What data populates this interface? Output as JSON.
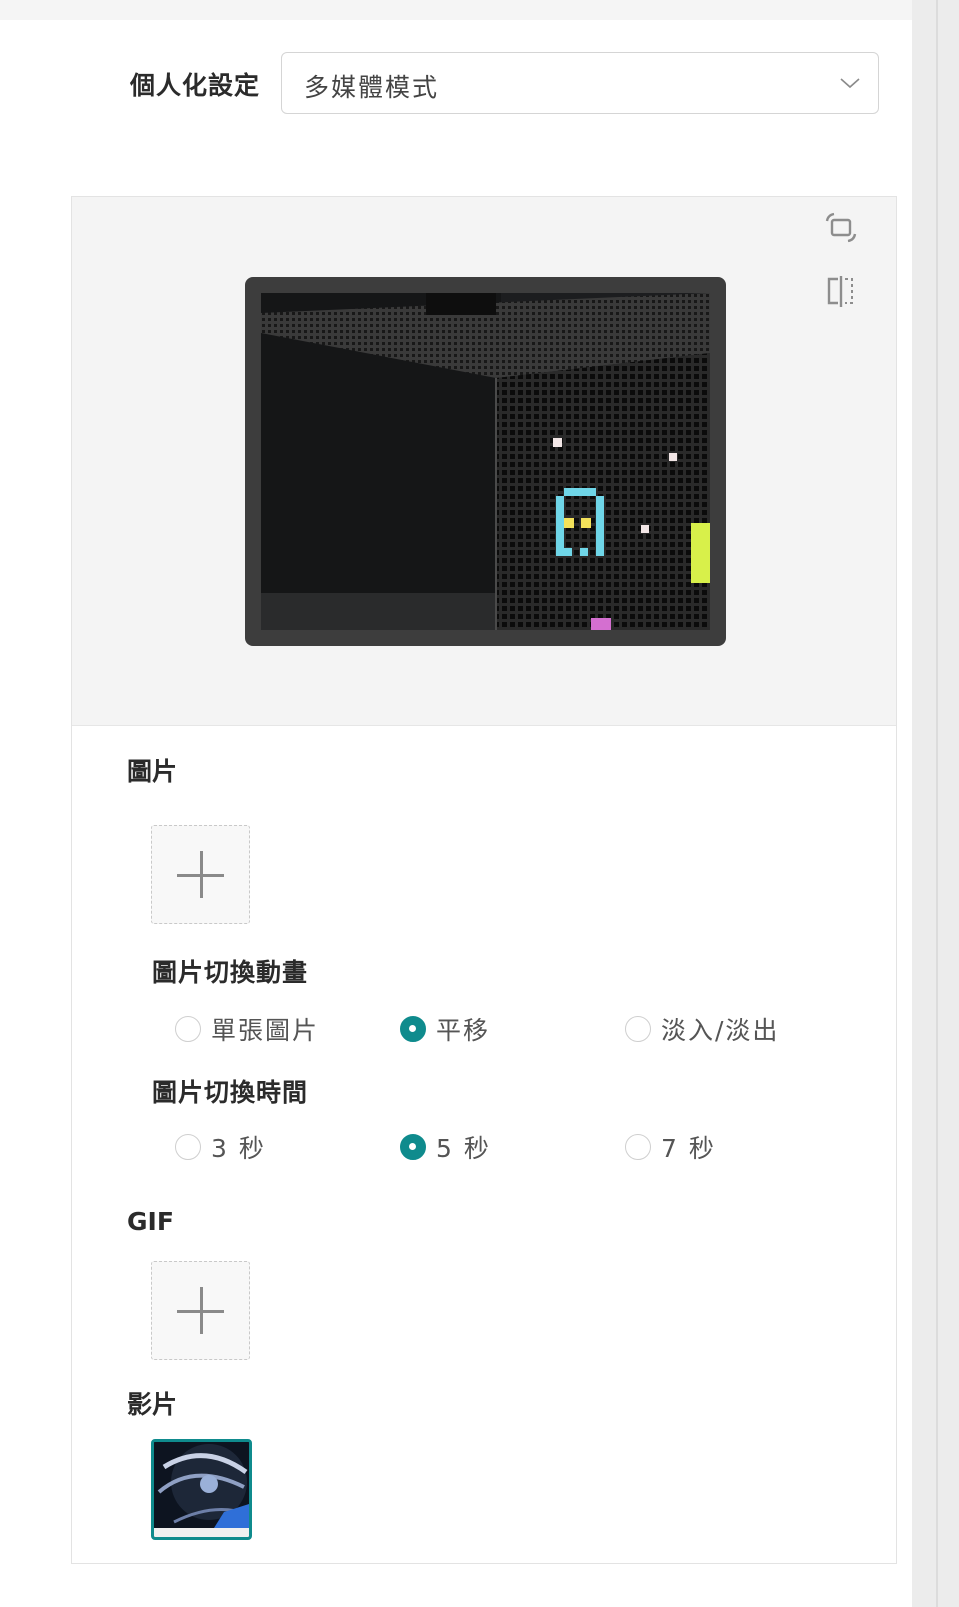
{
  "settings": {
    "label": "個人化設定",
    "selected_mode": "多媒體模式"
  },
  "preview": {
    "rotate_icon": "rotate-icon",
    "mirror_icon": "mirror-icon"
  },
  "image_section": {
    "title": "圖片",
    "animation_title": "圖片切換動畫",
    "animation_options": [
      "單張圖片",
      "平移",
      "淡入/淡出"
    ],
    "animation_selected": "平移",
    "time_title": "圖片切換時間",
    "time_options": [
      "3 秒",
      "5 秒",
      "7 秒"
    ],
    "time_selected": "5 秒"
  },
  "gif_section": {
    "title": "GIF"
  },
  "video_section": {
    "title": "影片"
  },
  "colors": {
    "accent": "#0f8b8d"
  }
}
